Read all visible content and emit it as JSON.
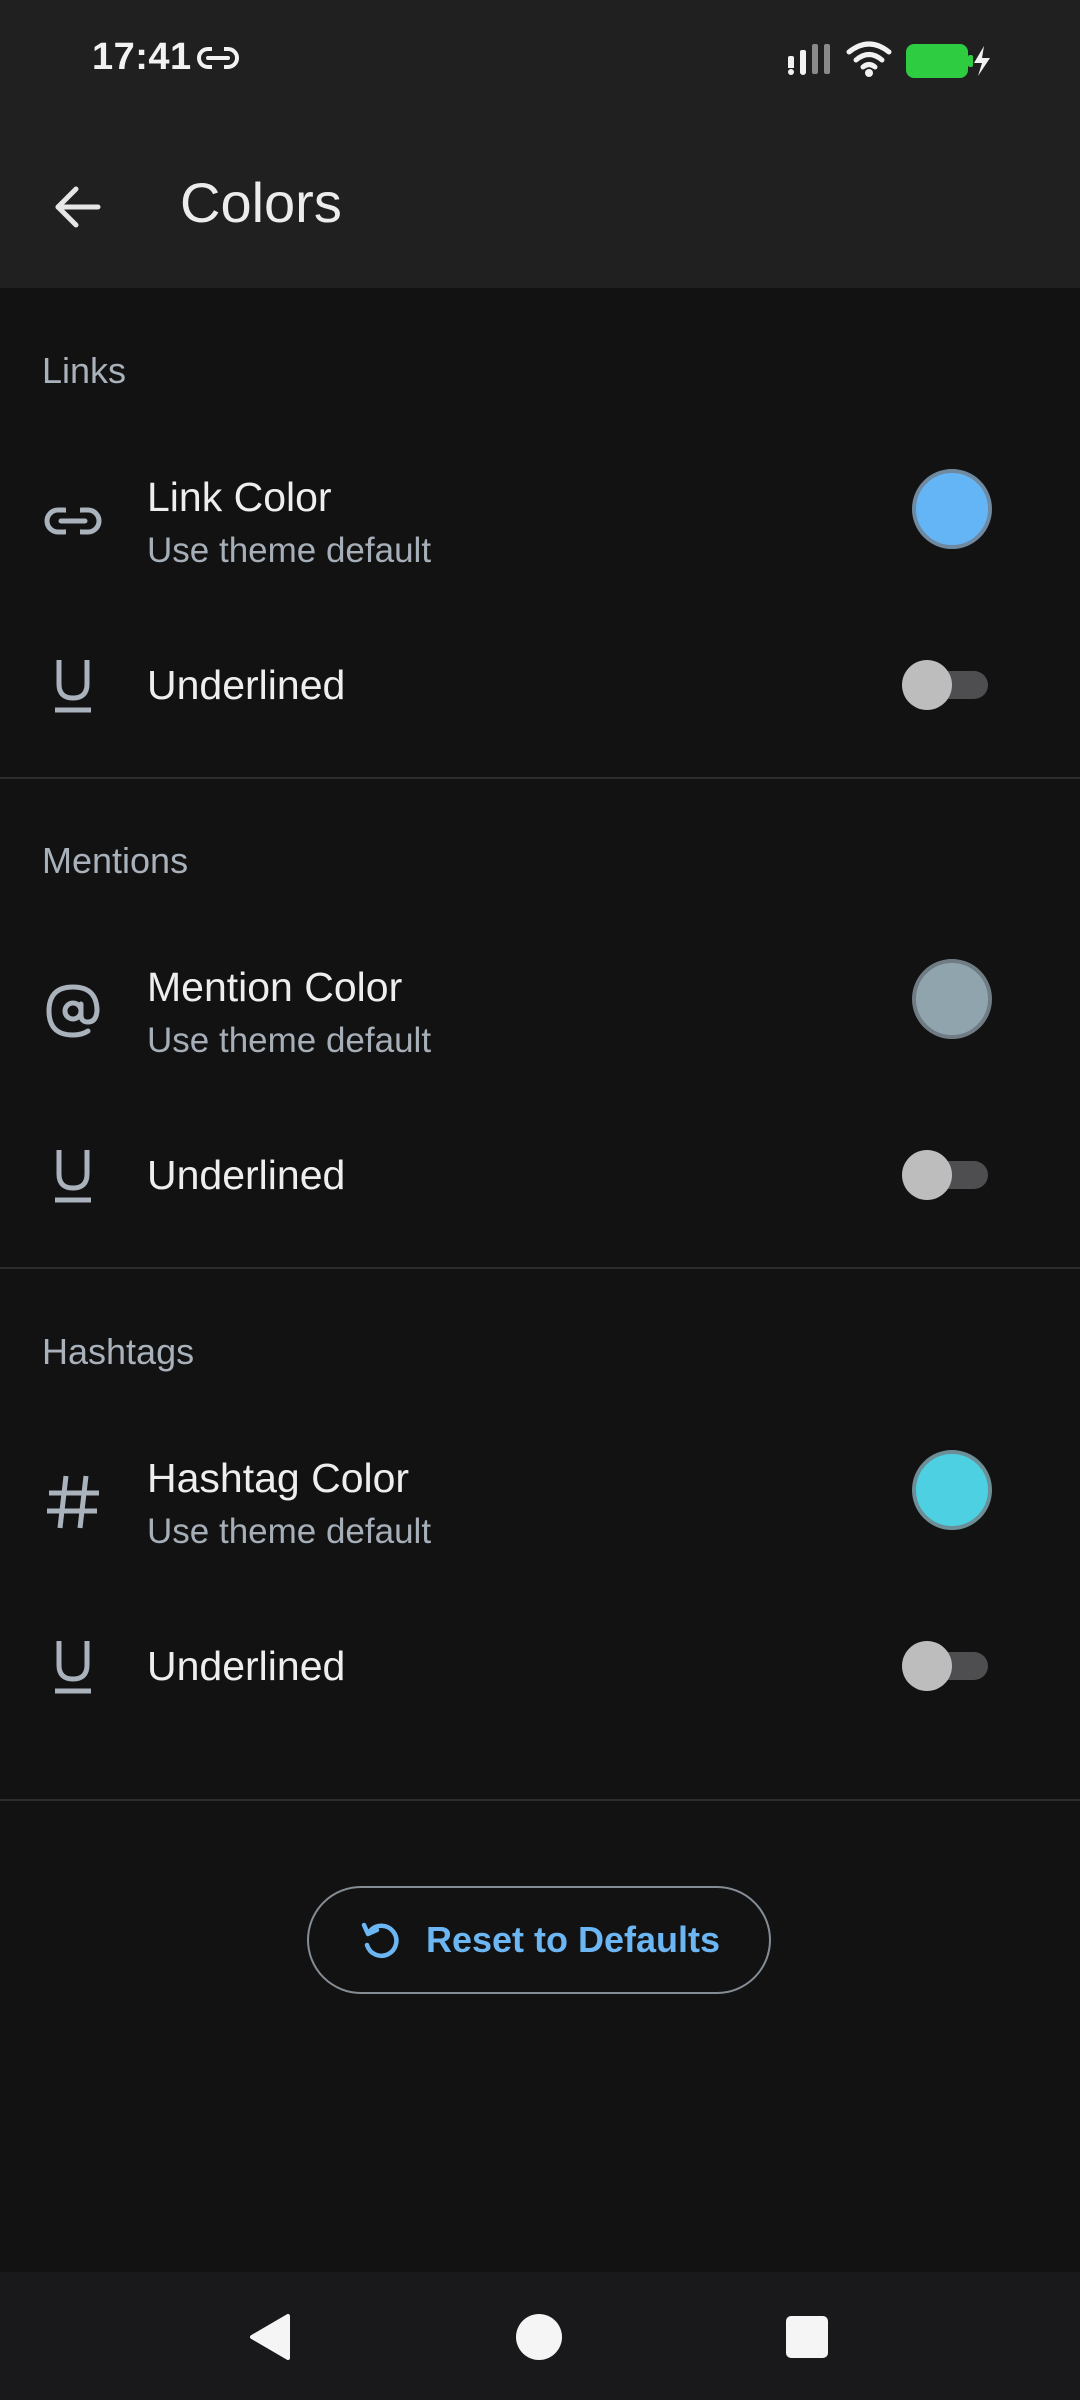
{
  "status_bar": {
    "time": "17:41",
    "icons": [
      "link-icon",
      "signal-icon",
      "wifi-icon",
      "battery-charging-icon"
    ],
    "battery_color": "#2ecc40"
  },
  "app_bar": {
    "back_icon": "arrow-back-icon",
    "title": "Colors"
  },
  "sections": [
    {
      "header": "Links",
      "color_row": {
        "icon": "link-icon",
        "title": "Link Color",
        "subtitle": "Use theme default",
        "swatch_color": "#64b5f6"
      },
      "underline_row": {
        "icon": "underline-icon",
        "title": "Underlined",
        "enabled": false
      }
    },
    {
      "header": "Mentions",
      "color_row": {
        "icon": "at-sign-icon",
        "title": "Mention Color",
        "subtitle": "Use theme default",
        "swatch_color": "#90a4ae"
      },
      "underline_row": {
        "icon": "underline-icon",
        "title": "Underlined",
        "enabled": false
      }
    },
    {
      "header": "Hashtags",
      "color_row": {
        "icon": "hashtag-icon",
        "title": "Hashtag Color",
        "subtitle": "Use theme default",
        "swatch_color": "#4dd0e1"
      },
      "underline_row": {
        "icon": "underline-icon",
        "title": "Underlined",
        "enabled": false
      }
    }
  ],
  "reset_button": {
    "icon": "refresh-icon",
    "label": "Reset to Defaults"
  },
  "nav_bar": {
    "icons": [
      "nav-back-icon",
      "nav-home-icon",
      "nav-recents-icon"
    ]
  },
  "colors": {
    "background": "#121213",
    "app_bar": "#202021",
    "accent": "#6cb6f3"
  }
}
